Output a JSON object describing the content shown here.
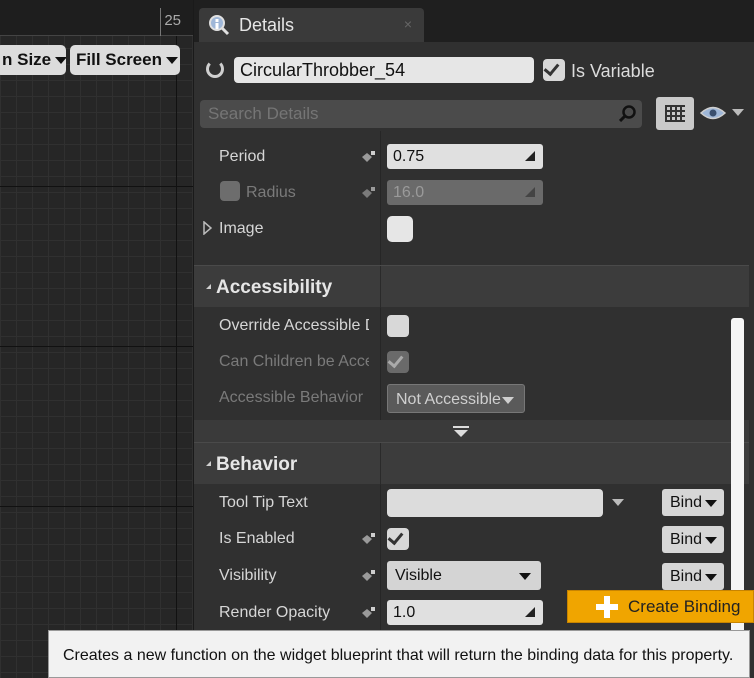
{
  "canvas": {
    "ruler_number": "25",
    "screen_size_label": "n Size",
    "fill_screen_label": "Fill Screen"
  },
  "details": {
    "tab_title": "Details",
    "tab_close": "×",
    "widget_name": "CircularThrobber_54",
    "is_variable_label": "Is Variable",
    "is_variable_checked": true,
    "search_placeholder": "Search Details"
  },
  "appearance": {
    "period_label": "Period",
    "period_value": "0.75",
    "radius_label": "Radius",
    "radius_value": "16.0",
    "image_label": "Image"
  },
  "accessibility": {
    "title": "Accessibility",
    "override_label": "Override Accessible De",
    "children_label": "Can Children be Access",
    "behavior_label": "Accessible Behavior",
    "behavior_value": "Not Accessible"
  },
  "behavior": {
    "title": "Behavior",
    "tooltip_label": "Tool Tip Text",
    "tooltip_value": "",
    "enabled_label": "Is Enabled",
    "visibility_label": "Visibility",
    "visibility_value": "Visible",
    "opacity_label": "Render Opacity",
    "opacity_value": "1.0",
    "bind_label": "Bind"
  },
  "create_binding": {
    "label": "Create Binding"
  },
  "tooltip": {
    "text": "Creates a new function on the widget blueprint that will return the binding data for this property."
  },
  "colors": {
    "accent": "#f0a500",
    "panel": "#303030",
    "section": "#3c3c3c"
  }
}
